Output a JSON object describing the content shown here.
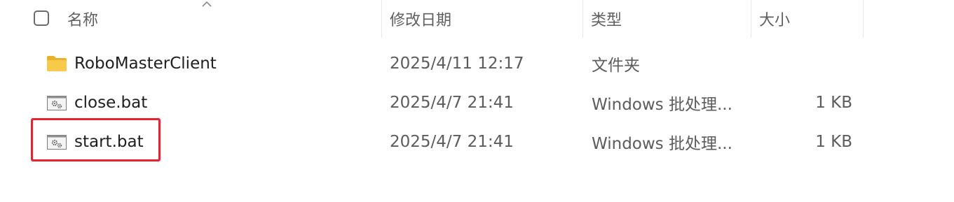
{
  "header": {
    "name": "名称",
    "date": "修改日期",
    "type": "类型",
    "size": "大小"
  },
  "icons": {
    "sort": "chevron-up-icon",
    "folder": "folder-icon",
    "batch": "batch-file-icon"
  },
  "colors": {
    "folder": "#f5c342",
    "highlight": "#e8222f"
  },
  "files": [
    {
      "name": "RoboMasterClient",
      "date": "2025/4/11 12:17",
      "type": "文件夹",
      "size": "",
      "icon": "folder"
    },
    {
      "name": "close.bat",
      "date": "2025/4/7 21:41",
      "type": "Windows 批处理...",
      "size": "1 KB",
      "icon": "batch"
    },
    {
      "name": "start.bat",
      "date": "2025/4/7 21:41",
      "type": "Windows 批处理...",
      "size": "1 KB",
      "icon": "batch"
    }
  ]
}
